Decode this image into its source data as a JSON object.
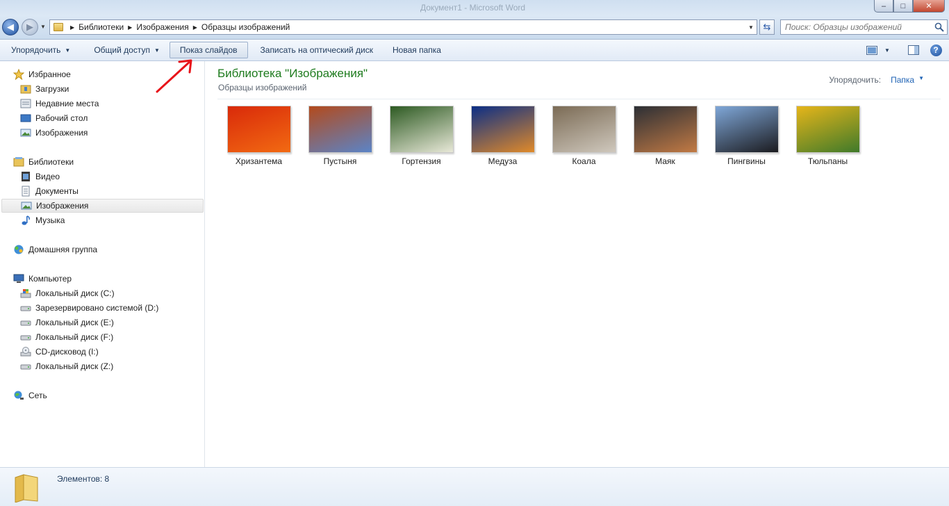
{
  "window": {
    "faint_title": "Документ1 - Microsoft Word",
    "buttons": {
      "minimize": "–",
      "maximize": "□",
      "close": "✕"
    }
  },
  "address": {
    "breadcrumb": [
      "Библиотеки",
      "Изображения",
      "Образцы изображений"
    ]
  },
  "search": {
    "placeholder": "Поиск: Образцы изображений"
  },
  "toolbar": {
    "organize": "Упорядочить",
    "share": "Общий доступ",
    "slideshow": "Показ слайдов",
    "burn": "Записать на оптический диск",
    "new_folder": "Новая папка"
  },
  "sidebar": {
    "favorites": {
      "header": "Избранное",
      "items": [
        "Загрузки",
        "Недавние места",
        "Рабочий стол",
        "Изображения"
      ]
    },
    "libraries": {
      "header": "Библиотеки",
      "items": [
        "Видео",
        "Документы",
        "Изображения",
        "Музыка"
      ],
      "selected": "Изображения"
    },
    "homegroup": {
      "header": "Домашняя группа"
    },
    "computer": {
      "header": "Компьютер",
      "items": [
        "Локальный диск (C:)",
        "Зарезервировано системой (D:)",
        "Локальный диск (E:)",
        "Локальный диск (F:)",
        "CD-дисковод (I:)",
        "Локальный диск (Z:)"
      ]
    },
    "network": {
      "header": "Сеть"
    }
  },
  "main": {
    "title": "Библиотека \"Изображения\"",
    "subtitle": "Образцы изображений",
    "arrange_label": "Упорядочить:",
    "arrange_value": "Папка",
    "files": [
      {
        "name": "Хризантема",
        "colors": [
          "#d92a0a",
          "#f26a12"
        ]
      },
      {
        "name": "Пустыня",
        "colors": [
          "#b34a1c",
          "#5b84c7"
        ]
      },
      {
        "name": "Гортензия",
        "colors": [
          "#2d5a22",
          "#e8e8d8"
        ]
      },
      {
        "name": "Медуза",
        "colors": [
          "#0b2e86",
          "#e08a2a"
        ]
      },
      {
        "name": "Коала",
        "colors": [
          "#7b6b55",
          "#cfc8bd"
        ]
      },
      {
        "name": "Маяк",
        "colors": [
          "#2c2f35",
          "#c27a44"
        ]
      },
      {
        "name": "Пингвины",
        "colors": [
          "#7fa7d8",
          "#1b1b1f"
        ]
      },
      {
        "name": "Тюльпаны",
        "colors": [
          "#e6b51a",
          "#3f7a2a"
        ]
      }
    ]
  },
  "status": {
    "items_count": "Элементов: 8"
  }
}
